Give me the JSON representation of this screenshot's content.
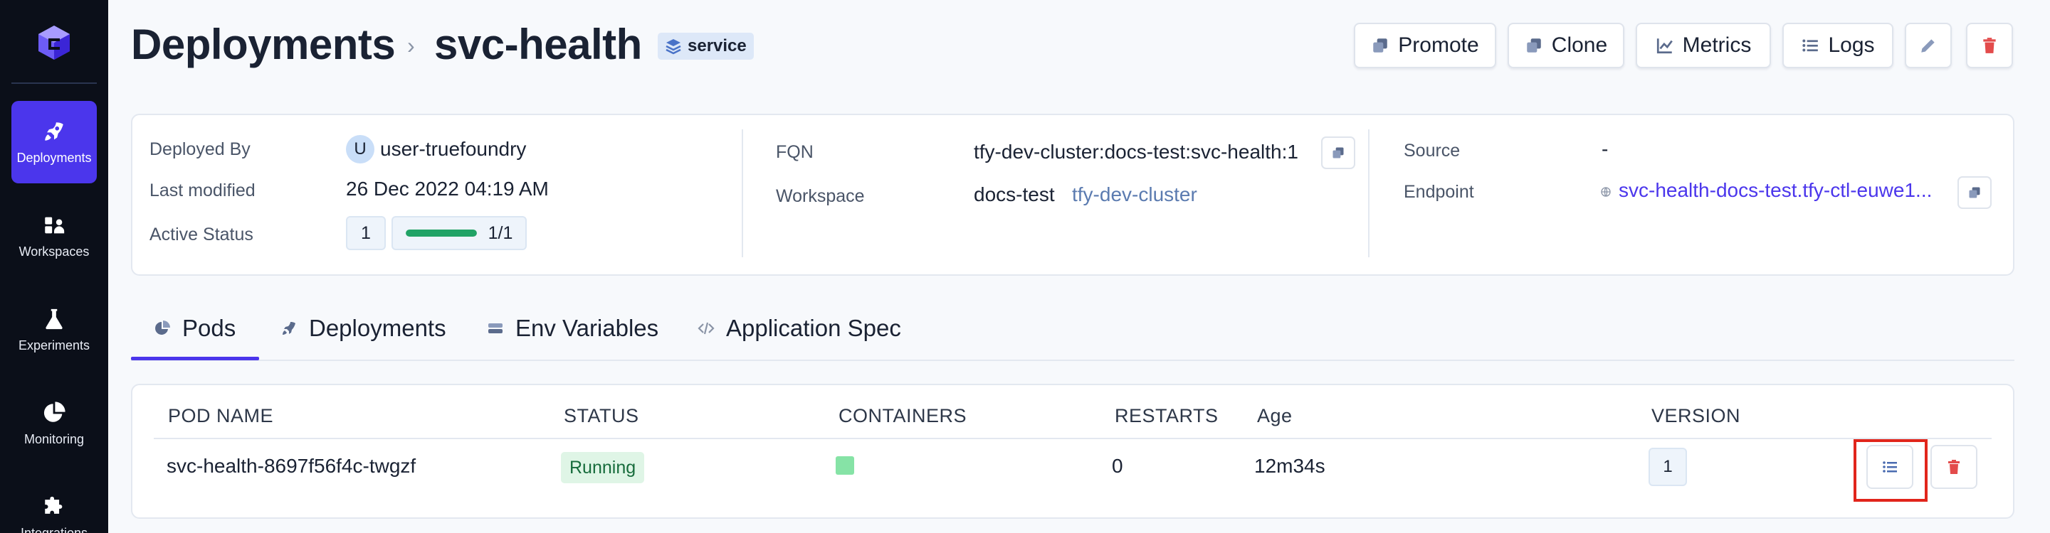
{
  "sidebar": {
    "items": [
      {
        "label": "Deployments",
        "icon": "rocket-icon",
        "active": true
      },
      {
        "label": "Workspaces",
        "icon": "workspaces-icon",
        "active": false
      },
      {
        "label": "Experiments",
        "icon": "flask-icon",
        "active": false
      },
      {
        "label": "Monitoring",
        "icon": "pie-chart-icon",
        "active": false
      },
      {
        "label": "Integrations",
        "icon": "puzzle-icon",
        "active": false
      }
    ]
  },
  "header": {
    "breadcrumb_root": "Deployments",
    "separator": "›",
    "name": "svc-health",
    "type_badge": "service",
    "buttons": {
      "promote": "Promote",
      "clone": "Clone",
      "metrics": "Metrics",
      "logs": "Logs"
    }
  },
  "info": {
    "deployed_by_label": "Deployed By",
    "deployed_by_avatar": "U",
    "deployed_by": "user-truefoundry",
    "last_modified_label": "Last modified",
    "last_modified": "26 Dec 2022 04:19 AM",
    "active_status_label": "Active Status",
    "active_count": "1",
    "active_ratio": "1/1",
    "active_progress": 1.0,
    "fqn_label": "FQN",
    "fqn": "tfy-dev-cluster:docs-test:svc-health:1",
    "workspace_label": "Workspace",
    "workspace": "docs-test",
    "cluster": "tfy-dev-cluster",
    "source_label": "Source",
    "source": "-",
    "endpoint_label": "Endpoint",
    "endpoint": "svc-health-docs-test.tfy-ctl-euwe1..."
  },
  "tabs": [
    {
      "label": "Pods",
      "icon": "pie-chart-icon",
      "active": true
    },
    {
      "label": "Deployments",
      "icon": "rocket-icon",
      "active": false
    },
    {
      "label": "Env Variables",
      "icon": "env-variables-icon",
      "active": false
    },
    {
      "label": "Application Spec",
      "icon": "code-icon",
      "active": false
    }
  ],
  "pods_table": {
    "columns": [
      "POD NAME",
      "STATUS",
      "CONTAINERS",
      "RESTARTS",
      "Age",
      "VERSION"
    ],
    "rows": [
      {
        "pod_name": "svc-health-8697f56f4c-twgzf",
        "status": "Running",
        "restarts": "0",
        "age": "12m34s",
        "version": "1"
      }
    ]
  },
  "colors": {
    "accent": "#4b36ec",
    "sidebar_bg": "#0b0f19",
    "running_bg": "#dff5e6",
    "danger": "#e1251b"
  }
}
